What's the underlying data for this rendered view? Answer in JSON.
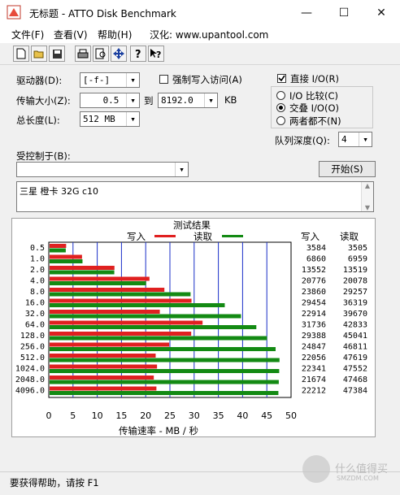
{
  "window": {
    "title": "无标题 - ATTO Disk Benchmark",
    "minimize": "—",
    "maximize": "☐",
    "close": "✕"
  },
  "menu": [
    {
      "label": "文件(F)"
    },
    {
      "label": "查看(V)"
    },
    {
      "label": "帮助(H)"
    },
    {
      "label": "汉化: www.upantool.com"
    }
  ],
  "toolbar": [
    "new-icon",
    "open-icon",
    "save-icon",
    "print-icon",
    "print-preview-icon",
    "move-icon",
    "help-icon",
    "context-help-icon"
  ],
  "settings": {
    "drive_label": "驱动器(D):",
    "drive_value": "[-f-]",
    "transfer_size_label": "传输大小(Z):",
    "transfer_min": "0.5",
    "to_label": "到",
    "transfer_max": "8192.0",
    "kb_label": "KB",
    "total_length_label": "总长度(L):",
    "total_length_value": "512 MB",
    "force_write_label": "强制写入访问(A)",
    "direct_io_label": "直接 I/O(R)",
    "io_compare_label": "I/O 比较(C)",
    "overlapped_io_label": "交叠 I/O(O)",
    "neither_label": "两者都不(N)",
    "queue_depth_label": "队列深度(Q):",
    "queue_depth_value": "4",
    "controlled_by_label": "受控制于(B):",
    "controlled_by_value": "",
    "start_button": "开始(S)",
    "description": "三星 橙卡 32G c10"
  },
  "results": {
    "title": "测试结果",
    "legend_write": "写入",
    "legend_read": "读取",
    "col_write": "写入",
    "col_read": "读取",
    "xlabel": "传输速率 - MB / 秒"
  },
  "chart_data": {
    "type": "bar",
    "title": "测试结果",
    "xlabel": "传输速率 - MB / 秒",
    "xlim": [
      0,
      50
    ],
    "x_ticks": [
      "0",
      "5",
      "10",
      "15",
      "20",
      "25",
      "30",
      "35",
      "40",
      "45",
      "50"
    ],
    "categories": [
      "0.5",
      "1.0",
      "2.0",
      "4.0",
      "8.0",
      "16.0",
      "32.0",
      "64.0",
      "128.0",
      "256.0",
      "512.0",
      "1024.0",
      "2048.0",
      "4096.0"
    ],
    "series": [
      {
        "name": "写入",
        "color": "#e02020",
        "values": [
          3.584,
          6.86,
          13.552,
          20.776,
          23.86,
          29.454,
          22.914,
          31.736,
          29.388,
          24.847,
          22.056,
          22.341,
          21.674,
          22.212
        ]
      },
      {
        "name": "读取",
        "color": "#138a13",
        "values": [
          3.505,
          6.959,
          13.519,
          20.078,
          29.257,
          36.319,
          39.67,
          42.833,
          45.041,
          46.811,
          47.619,
          47.552,
          47.468,
          47.384
        ]
      }
    ],
    "write_labels": [
      "3584",
      "6860",
      "13552",
      "20776",
      "23860",
      "29454",
      "22914",
      "31736",
      "29388",
      "24847",
      "22056",
      "22341",
      "21674",
      "22212"
    ],
    "read_labels": [
      "3505",
      "6959",
      "13519",
      "20078",
      "29257",
      "36319",
      "39670",
      "42833",
      "45041",
      "46811",
      "47619",
      "47552",
      "47468",
      "47384"
    ]
  },
  "status": {
    "text": "要获得帮助，请按 F1"
  },
  "watermark": {
    "text": "什么值得买",
    "sub": "SMZDM.COM"
  }
}
